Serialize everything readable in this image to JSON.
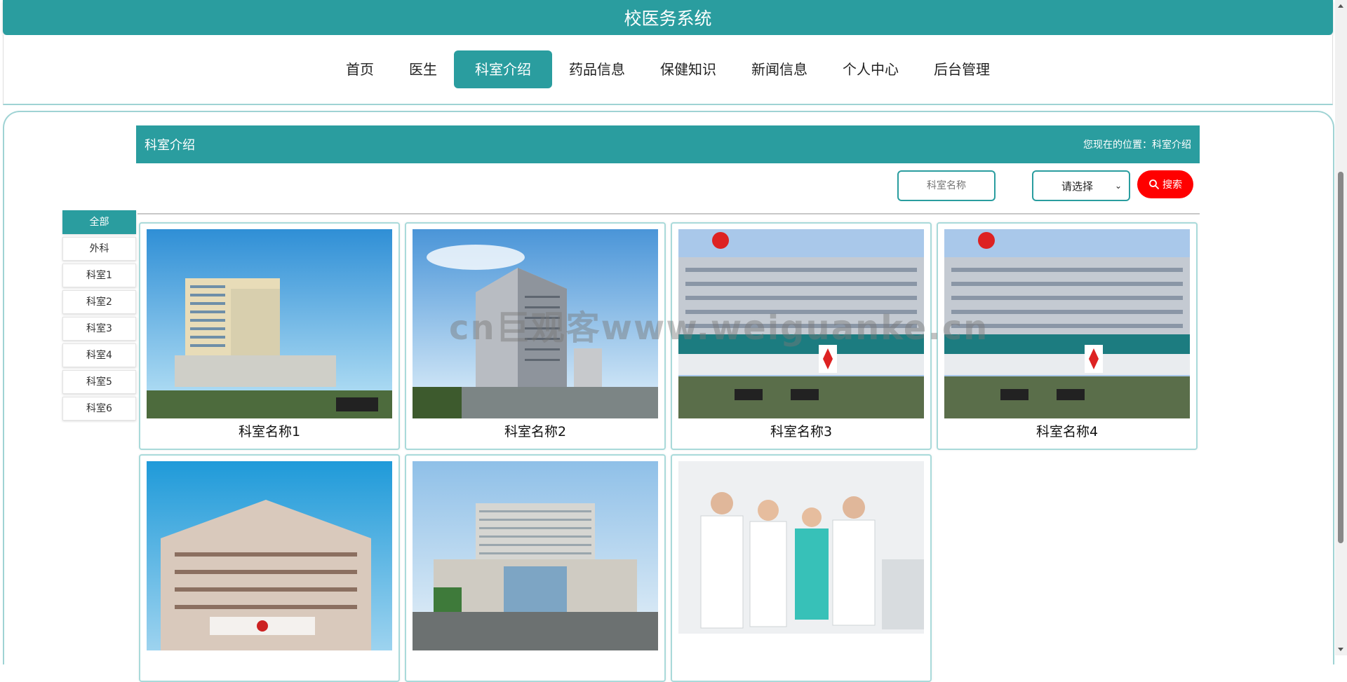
{
  "header": {
    "title": "校医务系统"
  },
  "nav": {
    "items": [
      {
        "label": "首页"
      },
      {
        "label": "医生"
      },
      {
        "label": "科室介绍"
      },
      {
        "label": "药品信息"
      },
      {
        "label": "保健知识"
      },
      {
        "label": "新闻信息"
      },
      {
        "label": "个人中心"
      },
      {
        "label": "后台管理"
      }
    ],
    "active_index": 2
  },
  "section": {
    "title": "科室介绍",
    "location": "您现在的位置：科室介绍"
  },
  "search": {
    "placeholder": "科室名称",
    "select_value": "请选择",
    "button_label": "搜索"
  },
  "sidebar": {
    "items": [
      {
        "label": "全部"
      },
      {
        "label": "外科"
      },
      {
        "label": "科室1"
      },
      {
        "label": "科室2"
      },
      {
        "label": "科室3"
      },
      {
        "label": "科室4"
      },
      {
        "label": "科室5"
      },
      {
        "label": "科室6"
      }
    ],
    "active_index": 0
  },
  "cards": [
    {
      "name": "科室名称1"
    },
    {
      "name": "科室名称2"
    },
    {
      "name": "科室名称3"
    },
    {
      "name": "科室名称4"
    },
    {
      "name": ""
    },
    {
      "name": ""
    },
    {
      "name": ""
    }
  ],
  "watermark": "cn巨观客www.weiguanke.cn",
  "colors": {
    "brand": "#2a9d9f",
    "search_button": "#ff0000"
  }
}
